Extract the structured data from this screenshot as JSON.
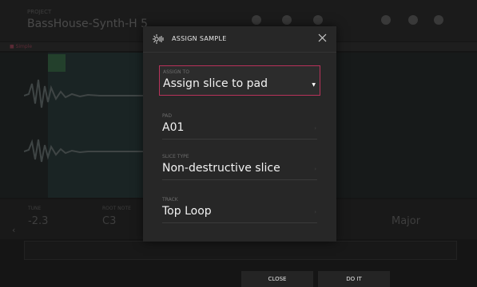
{
  "background": {
    "header_sub": "PROJECT",
    "project_title": "BassHouse-Synth-H 5",
    "tab_label": "■ Simple",
    "params": {
      "tune_label": "TUNE",
      "tune_value": "-2.3",
      "root_label": "ROOT NOTE",
      "root_value": "C3",
      "mode_value": "Major"
    }
  },
  "modal": {
    "icon": "assign-sample-icon",
    "title": "ASSIGN SAMPLE",
    "fields": [
      {
        "label": "ASSIGN TO",
        "value": "Assign slice to pad"
      },
      {
        "label": "PAD",
        "value": "A01"
      },
      {
        "label": "SLICE TYPE",
        "value": "Non-destructive slice"
      },
      {
        "label": "TRACK",
        "value": "Top Loop"
      }
    ]
  },
  "footer": {
    "close_label": "CLOSE",
    "doit_label": "DO IT"
  },
  "colors": {
    "accent": "#b8325a",
    "modal_bg": "#272727",
    "app_bg": "#151515"
  }
}
